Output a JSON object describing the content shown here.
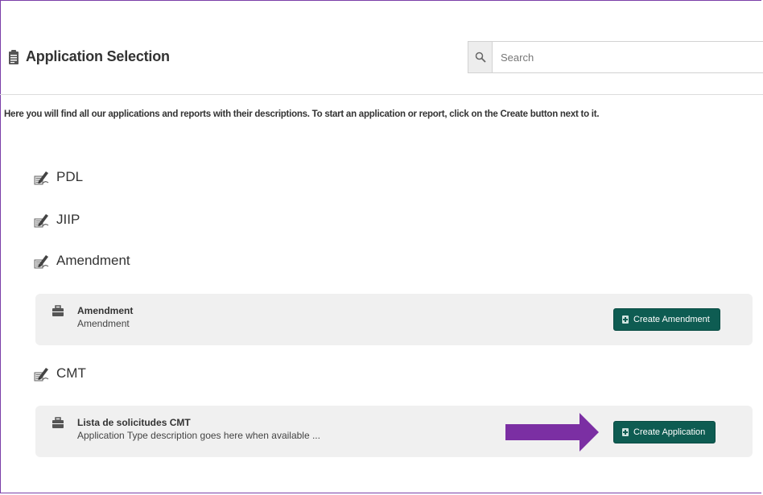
{
  "header": {
    "title": "Application Selection",
    "search": {
      "placeholder": "Search",
      "value": ""
    }
  },
  "intro_text": "Here you will find all our applications and reports with their descriptions. To start an application or report, click on the Create button next to it.",
  "categories": [
    {
      "label": "PDL"
    },
    {
      "label": "JIIP"
    },
    {
      "label": "Amendment"
    },
    {
      "label": "CMT"
    }
  ],
  "applications": [
    {
      "name": "Amendment",
      "description": "Amendment",
      "button_label": "Create Amendment"
    },
    {
      "name": "Lista de solicitudes CMT",
      "description": "Application Type description goes here when available ...",
      "button_label": "Create Application"
    }
  ],
  "colors": {
    "button_bg": "#0e5c52",
    "card_bg": "#f0f0f0",
    "annotation_arrow": "#7b2fa3",
    "frame_border": "#7b3fa8"
  }
}
